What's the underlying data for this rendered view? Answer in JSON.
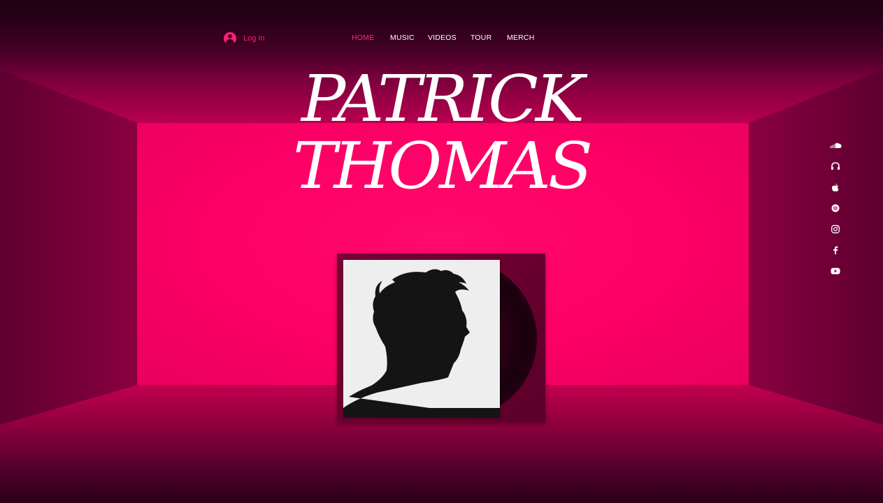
{
  "header": {
    "login_label": "Log In",
    "nav": [
      {
        "label": "HOME",
        "active": true
      },
      {
        "label": "MUSIC",
        "active": false
      },
      {
        "label": "VIDEOS",
        "active": false
      },
      {
        "label": "TOUR",
        "active": false
      },
      {
        "label": "MERCH",
        "active": false
      }
    ]
  },
  "hero": {
    "title_line1": "PATRICK",
    "title_line2": "THOMAS"
  },
  "social": [
    "soundcloud-icon",
    "headphones-icon",
    "apple-icon",
    "spotify-icon",
    "instagram-icon",
    "facebook-icon",
    "youtube-icon"
  ],
  "colors": {
    "accent": "#ff1f72",
    "back_wall": "#ff0066",
    "text": "#ffffff"
  }
}
